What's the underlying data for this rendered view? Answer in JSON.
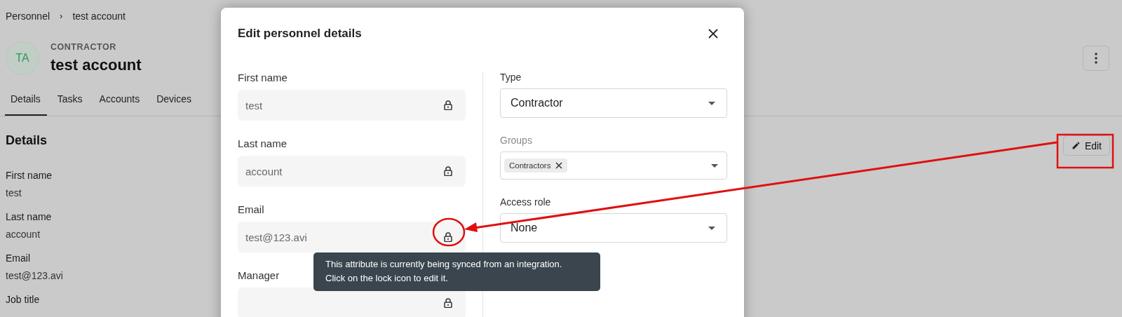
{
  "breadcrumb": {
    "parent": "Personnel",
    "separator": "›",
    "current": "test account"
  },
  "header": {
    "initials": "TA",
    "type_label": "CONTRACTOR",
    "name": "test account"
  },
  "tabs": [
    {
      "label": "Details",
      "selected": true
    },
    {
      "label": "Tasks",
      "selected": false
    },
    {
      "label": "Accounts",
      "selected": false
    },
    {
      "label": "Devices",
      "selected": false
    }
  ],
  "details": {
    "title": "Details",
    "edit_button": "Edit",
    "fields": [
      {
        "label": "First name",
        "value": "test"
      },
      {
        "label": "Last name",
        "value": "account"
      },
      {
        "label": "Email",
        "value": "test@123.avi"
      },
      {
        "label": "Job title"
      }
    ]
  },
  "modal": {
    "title": "Edit personnel details",
    "left_fields": [
      {
        "label": "First name",
        "value": "test",
        "locked": true
      },
      {
        "label": "Last name",
        "value": "account",
        "locked": true
      },
      {
        "label": "Email",
        "value": "test@123.avi",
        "locked": true
      },
      {
        "label": "Manager",
        "locked": true
      }
    ],
    "right_fields": [
      {
        "kind": "select",
        "label": "Type",
        "value": "Contractor"
      },
      {
        "kind": "multiselect",
        "label": "Groups",
        "chips": [
          "Contractors"
        ]
      },
      {
        "kind": "select",
        "label": "Access role",
        "value": "None"
      }
    ],
    "tooltip": "This attribute is currently being synced from an integration. Click on the lock icon to edit it."
  }
}
